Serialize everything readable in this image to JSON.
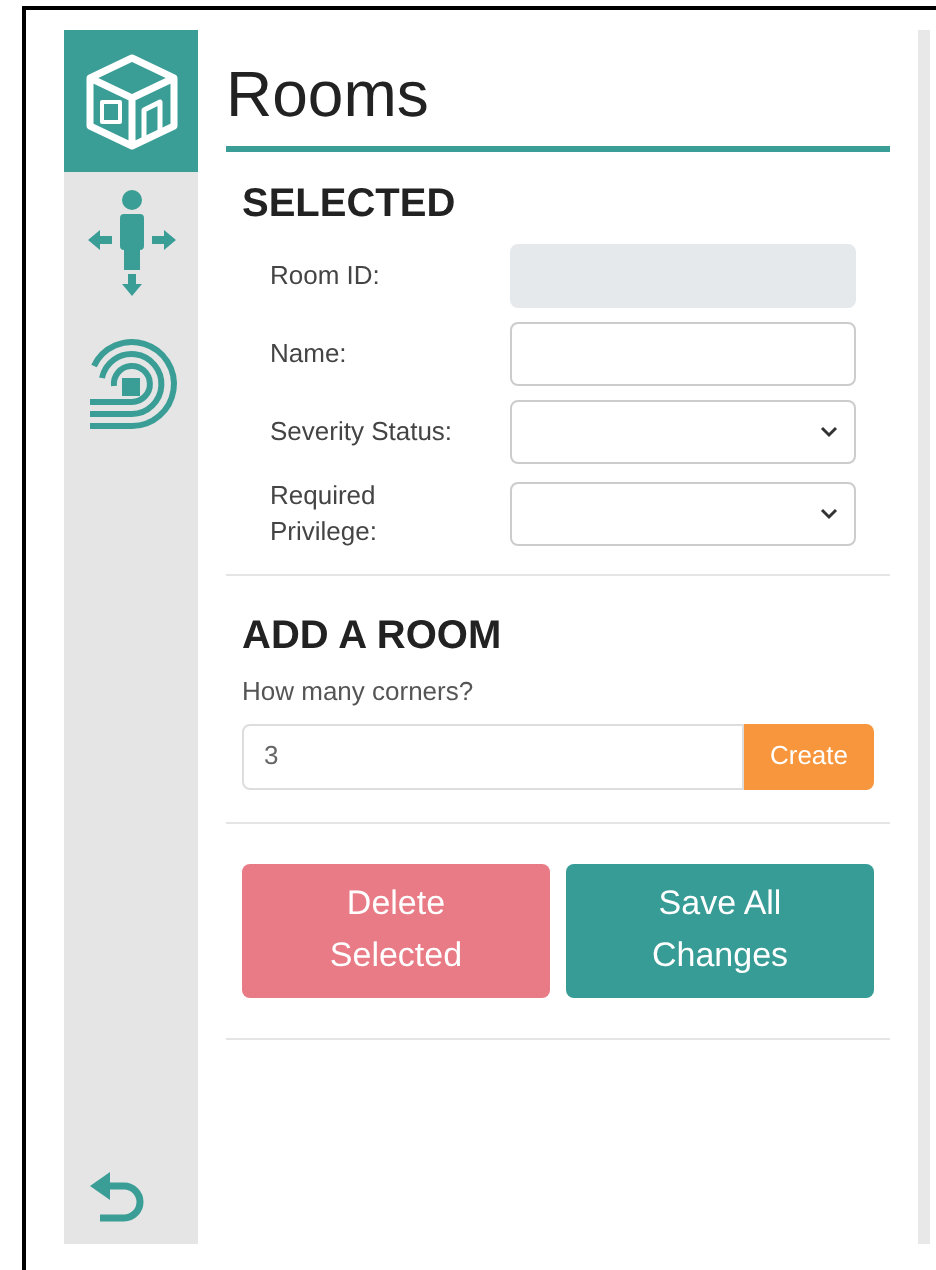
{
  "sidebar": {
    "items": [
      {
        "selected": true
      },
      {
        "selected": false
      },
      {
        "selected": false
      }
    ]
  },
  "title": "Rooms",
  "selected_section": {
    "heading": "SELECTED",
    "fields": [
      {
        "label": "Room ID:",
        "kind": "text",
        "disabled": true
      },
      {
        "label": "Name:",
        "kind": "text",
        "disabled": false
      },
      {
        "label": "Severity Status:",
        "kind": "select",
        "disabled": false
      },
      {
        "label": "Required Privilege:",
        "kind": "select",
        "disabled": false
      }
    ]
  },
  "add_section": {
    "heading": "ADD A ROOM",
    "prompt": "How many corners?",
    "value": "3",
    "button": "Create"
  },
  "buttons": [
    {
      "label": "Delete Selected",
      "kind": "danger"
    },
    {
      "label": "Save All Changes",
      "kind": "primary"
    }
  ]
}
